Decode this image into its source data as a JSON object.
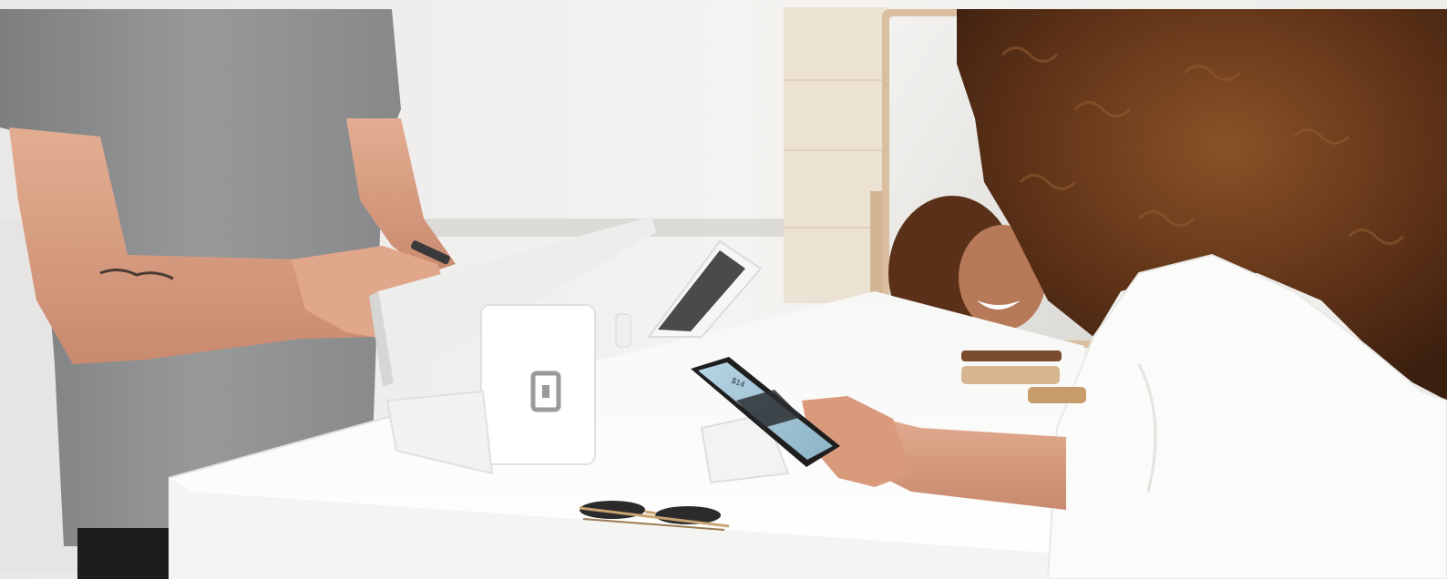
{
  "photo": {
    "phone_screen_text": "$14",
    "colors": {
      "wall": "#f1f0ee",
      "counter": "#fbfbfa",
      "shirt": "#8f9091",
      "skin": "#d9a084",
      "hair": "#6b3b1c",
      "blouse": "#fbfbfa",
      "wood": "#ead8c2",
      "phone_screen": "#9fc3d6"
    }
  }
}
